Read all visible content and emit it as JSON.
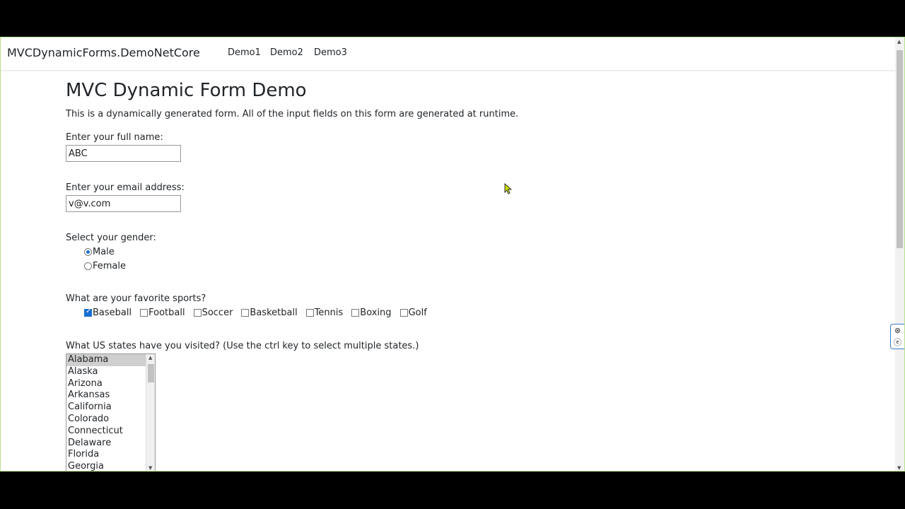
{
  "navbar": {
    "brand": "MVCDynamicForms.DemoNetCore",
    "links": [
      "Demo1",
      "Demo2",
      "Demo3"
    ]
  },
  "page": {
    "title": "MVC Dynamic Form Demo",
    "description": "This is a dynamically generated form. All of the input fields on this form are generated at runtime."
  },
  "form": {
    "name_label": "Enter your full name:",
    "name_value": "ABC",
    "email_label": "Enter your email address:",
    "email_value": "v@v.com",
    "gender_label": "Select your gender:",
    "gender_options": [
      "Male",
      "Female"
    ],
    "gender_selected": "Male",
    "sports_label": "What are your favorite sports?",
    "sports_options": [
      "Baseball",
      "Football",
      "Soccer",
      "Basketball",
      "Tennis",
      "Boxing",
      "Golf"
    ],
    "sports_checked": [
      "Baseball"
    ],
    "states_label": "What US states have you visited? (Use the ctrl key to select multiple states.)",
    "states_options": [
      "Alabama",
      "Alaska",
      "Arizona",
      "Arkansas",
      "California",
      "Colorado",
      "Connecticut",
      "Delaware",
      "Florida",
      "Georgia"
    ],
    "states_selected": [
      "Alabama"
    ]
  },
  "colors": {
    "accent": "#1a6fd3",
    "frame_border": "#b7e08a"
  }
}
